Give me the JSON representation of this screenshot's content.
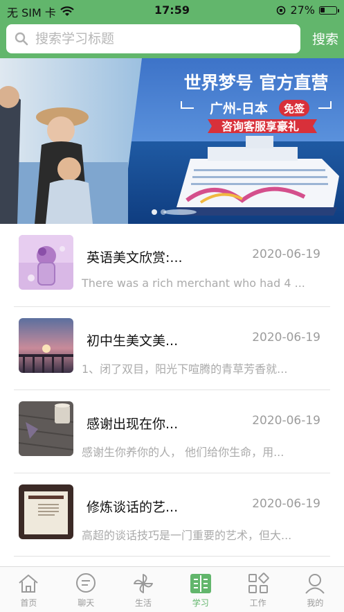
{
  "status_bar": {
    "carrier": "无 SIM 卡",
    "time": "17:59",
    "battery_percent": "27%",
    "battery_level": 0.27
  },
  "search": {
    "placeholder": "搜索学习标题",
    "button_label": "搜索"
  },
  "banner": {
    "headline": "世界梦号 官方直营",
    "route": "广州-日本",
    "visa_badge": "免签",
    "cta": "咨询客服享豪礼"
  },
  "articles": [
    {
      "title": "英语美文欣赏:...",
      "date": "2020-06-19",
      "excerpt": "There was a rich merchant who had 4 ...",
      "thumb": "flower-vase-image"
    },
    {
      "title": "初中生美文美...",
      "date": "2020-06-19",
      "excerpt": "1、闭了双目，阳光下喧腾的青草芳香就...",
      "thumb": "sunset-pier-image"
    },
    {
      "title": "感谢出现在你...",
      "date": "2020-06-19",
      "excerpt": "感谢生你养你的人， 他们给你生命，用...",
      "thumb": "cup-on-wood-image"
    },
    {
      "title": "修炼谈话的艺...",
      "date": "2020-06-19",
      "excerpt": "高超的谈话技巧是一门重要的艺术，但大...",
      "thumb": "book-cover-image"
    }
  ],
  "tabs": [
    {
      "label": "首页",
      "icon": "home-icon",
      "active": false
    },
    {
      "label": "聊天",
      "icon": "chat-icon",
      "active": false
    },
    {
      "label": "生活",
      "icon": "pinwheel-icon",
      "active": false
    },
    {
      "label": "学习",
      "icon": "book-icon",
      "active": true
    },
    {
      "label": "工作",
      "icon": "grid-icon",
      "active": false
    },
    {
      "label": "我的",
      "icon": "user-icon",
      "active": false
    }
  ],
  "colors": {
    "brand_green": "#62b66c",
    "inactive_gray": "#9a9a9a"
  }
}
